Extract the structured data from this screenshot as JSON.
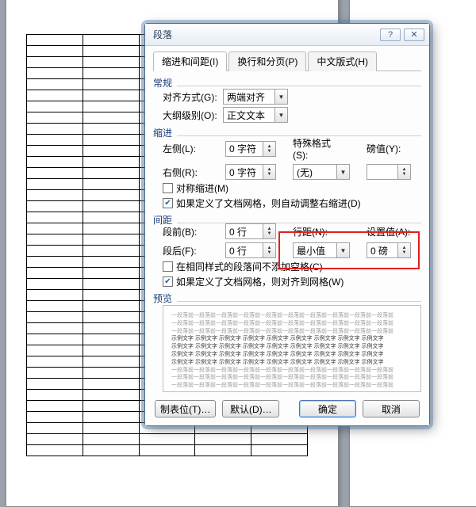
{
  "dialog": {
    "title": "段落",
    "help_symbol": "?",
    "close_symbol": "✕",
    "tabs": [
      "缩进和间距(I)",
      "换行和分页(P)",
      "中文版式(H)"
    ],
    "general": {
      "header": "常规",
      "align_label": "对齐方式(G):",
      "align_value": "两端对齐",
      "outline_label": "大纲级别(O):",
      "outline_value": "正文文本"
    },
    "indent": {
      "header": "缩进",
      "left_label": "左侧(L):",
      "left_value": "0 字符",
      "right_label": "右侧(R):",
      "right_value": "0 字符",
      "special_label": "特殊格式(S):",
      "special_value": "(无)",
      "by_label": "磅值(Y):",
      "by_value": "",
      "mirror_label": "对称缩进(M)",
      "grid_label": "如果定义了文档网格，则自动调整右缩进(D)"
    },
    "spacing": {
      "header": "间距",
      "before_label": "段前(B):",
      "before_value": "0 行",
      "after_label": "段后(F):",
      "after_value": "0 行",
      "line_label": "行距(N):",
      "line_value": "最小值",
      "at_label": "设置值(A):",
      "at_value": "0 磅",
      "nospace_label": "在相同样式的段落间不添加空格(C)",
      "snap_label": "如果定义了文档网格，则对齐到网格(W)"
    },
    "preview": {
      "header": "预览",
      "grey_line": "一段落前一段落前一段落前一段落前一段落前一段落前一段落前一段落前一段落前一段落前",
      "mid_line": "示例文字 示例文字 示例文字 示例文字 示例文字 示例文字 示例文字 示例文字 示例文字"
    },
    "buttons": {
      "tabs": "制表位(T)…",
      "default": "默认(D)…",
      "ok": "确定",
      "cancel": "取消"
    }
  }
}
